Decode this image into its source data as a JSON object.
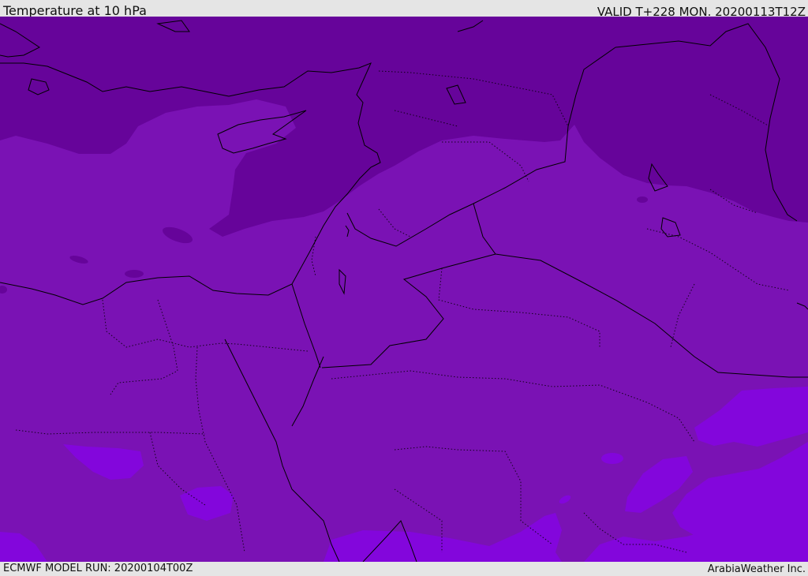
{
  "header": {
    "title": "Temperature at 10 hPa",
    "valid_time": "VALID T+228 MON. 20200113T12Z"
  },
  "footer": {
    "model_run": "ECMWF MODEL RUN: 20200104T00Z",
    "credit": "ArabiaWeather Inc."
  },
  "colors": {
    "dark_purple": "#66049a",
    "mid_purple": "#7a12b4",
    "light_purple": "#8306dc",
    "coastline": "#000000"
  }
}
